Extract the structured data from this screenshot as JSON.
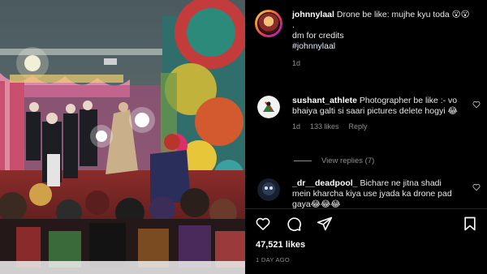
{
  "post": {
    "author": "johnnylaal",
    "caption_lines": [
      "Drone be like: mujhe kyu toda 😮😮",
      ".",
      "dm for credits"
    ],
    "hashtag": "#johnnylaal",
    "age": "1d"
  },
  "comments": [
    {
      "username": "sushant_athlete",
      "text": "Photographer be like :- vo bhaiya galti si saari pictures delete hogyi 😂",
      "age": "1d",
      "likes": "133 likes",
      "reply_label": "Reply",
      "view_replies": "View replies (7)"
    },
    {
      "username": "_dr__deadpool_",
      "text": "Bichare ne jitna shadi mein kharcha kiya use jyada ka drone pad gaya😂😂😂"
    }
  ],
  "actions": {
    "like_icon": "heart-icon",
    "comment_icon": "comment-icon",
    "share_icon": "share-icon",
    "save_icon": "bookmark-icon"
  },
  "stats": {
    "likes": "47,521 likes",
    "posted": "1 DAY AGO"
  },
  "colors": {
    "background": "#000000",
    "text": "#f5f5f5",
    "secondary": "#8e8e8e",
    "hashtag": "#e0f1ff"
  }
}
